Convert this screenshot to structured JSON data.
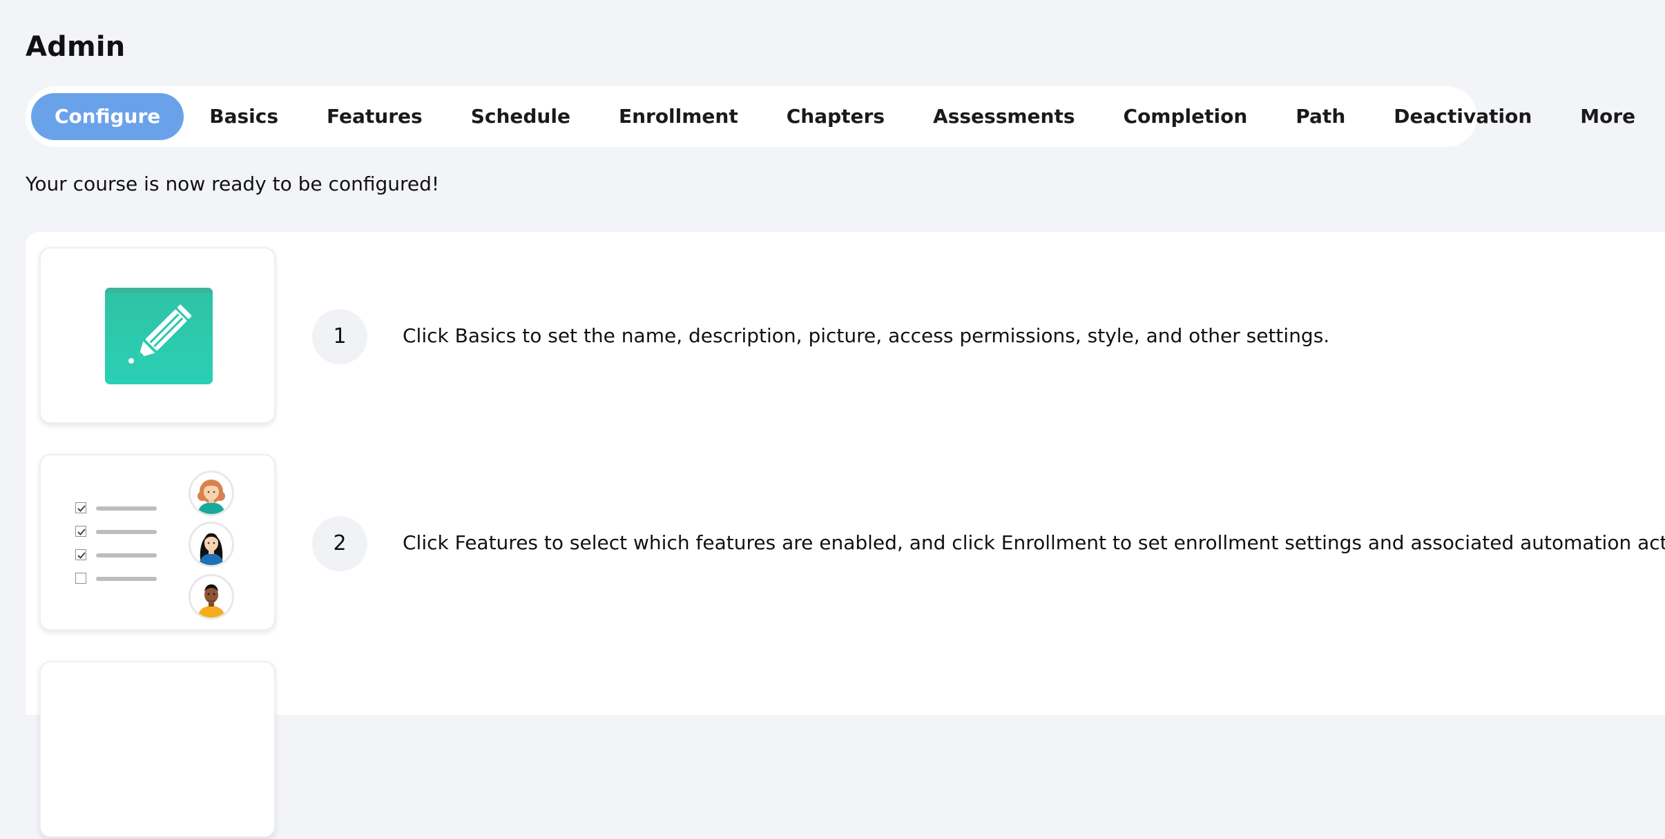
{
  "header": {
    "title": "Admin"
  },
  "tabs": [
    {
      "label": "Configure",
      "active": true
    },
    {
      "label": "Basics",
      "active": false
    },
    {
      "label": "Features",
      "active": false
    },
    {
      "label": "Schedule",
      "active": false
    },
    {
      "label": "Enrollment",
      "active": false
    },
    {
      "label": "Chapters",
      "active": false
    },
    {
      "label": "Assessments",
      "active": false
    },
    {
      "label": "Completion",
      "active": false
    },
    {
      "label": "Path",
      "active": false
    },
    {
      "label": "Deactivation",
      "active": false
    },
    {
      "label": "More",
      "active": false
    }
  ],
  "intro_text": "Your course is now ready to be configured!",
  "steps": [
    {
      "number": "1",
      "text": "Click Basics to set the name, description, picture, access permissions, style, and other settings.",
      "icon": "pencil-icon"
    },
    {
      "number": "2",
      "text": "Click Features to select which features are enabled, and click Enrollment to set enrollment settings and associated automation actions.",
      "icon": "checklist-icon"
    }
  ],
  "colors": {
    "accent": "#6aa2ea",
    "page_background": "#f3f4f8",
    "tile_teal": "#2ac7ad"
  }
}
